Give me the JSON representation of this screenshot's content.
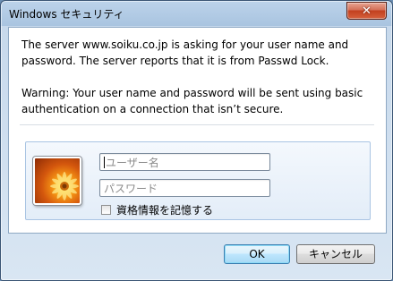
{
  "window": {
    "title": "Windows セキュリティ",
    "close_glyph": "✕"
  },
  "message": {
    "line1": "The server www.soiku.co.jp is asking for your user name and password. The server reports that it is from Passwd Lock.",
    "line2": "Warning: Your user name and password will be sent using basic authentication on a connection that isn’t secure."
  },
  "credentials": {
    "avatar_icon": "user-tile-flower-icon",
    "username_placeholder": "ユーザー名",
    "password_placeholder": "パスワード",
    "remember_label": "資格情報を記憶する",
    "remember_checked": false
  },
  "buttons": {
    "ok_label": "OK",
    "cancel_label": "キャンセル"
  },
  "colors": {
    "accent": "#3c7fb1",
    "panel_border": "#a9c4e3",
    "close_red": "#c2401f"
  }
}
